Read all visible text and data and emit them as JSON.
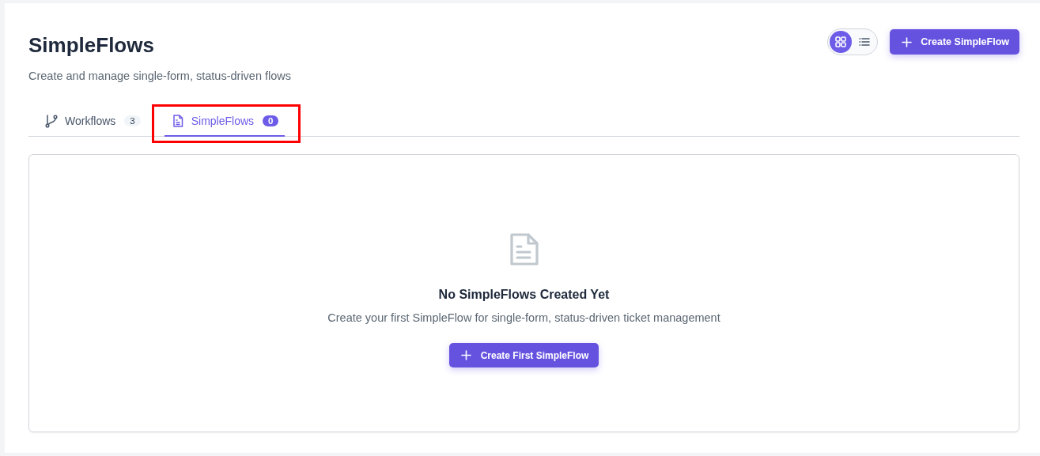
{
  "header": {
    "title": "SimpleFlows",
    "subtitle": "Create and manage single-form, status-driven flows"
  },
  "view_modes": [
    {
      "kind": "grid",
      "selected": true
    },
    {
      "kind": "list",
      "selected": false
    }
  ],
  "create_button": {
    "label": "Create SimpleFlow"
  },
  "tabs": [
    {
      "kind": "branch",
      "label": "Workflows",
      "count": "3",
      "selected": false,
      "highlighted": false
    },
    {
      "kind": "document",
      "label": "SimpleFlows",
      "count": "0",
      "selected": true,
      "highlighted": true
    }
  ],
  "empty_state": {
    "title": "No SimpleFlows Created Yet",
    "message": "Create your first SimpleFlow for single-form, status-driven ticket management",
    "button": "Create First SimpleFlow"
  }
}
